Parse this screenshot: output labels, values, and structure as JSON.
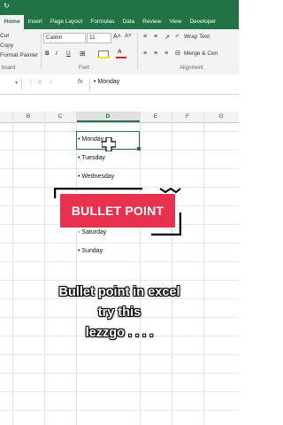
{
  "ribbon": {
    "tabs": [
      "Home",
      "Insert",
      "Page Layout",
      "Formulas",
      "Data",
      "Review",
      "View",
      "Developer"
    ],
    "clipboard": {
      "cut": "Cut",
      "copy": "Copy",
      "format_painter": "Format Painter",
      "group": "board"
    },
    "font": {
      "name": "Calibri",
      "size": "11",
      "bold": "B",
      "italic": "I",
      "underline": "U",
      "group": "Font"
    },
    "alignment": {
      "wrap_text": "Wrap Text",
      "merge": "Merge & Cen",
      "group": "Alignment"
    }
  },
  "formula_bar": {
    "fx": "fx",
    "value": "• Monday"
  },
  "columns": [
    "B",
    "C",
    "D",
    "E",
    "F",
    "G"
  ],
  "cells": {
    "monday": "• Monday",
    "tuesday": "• Tuesday",
    "wednesday": "• Wednesday",
    "saturday": "• Saturday",
    "sunday": "• Sunday"
  },
  "overlay": {
    "banner_text": "BULLET POINT",
    "caption_line1": "Bullet point in excel",
    "caption_line2": "try this",
    "caption_line3": "lezzgo . . . ."
  },
  "colors": {
    "excel_green": "#217346",
    "banner_red": "#e8304f"
  }
}
